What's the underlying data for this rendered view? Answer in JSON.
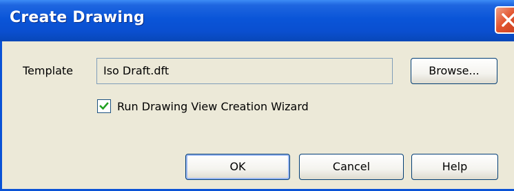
{
  "window": {
    "title": "Create Drawing"
  },
  "form": {
    "template_label": "Template",
    "template_value": "Iso Draft.dft",
    "browse_label": "Browse...",
    "wizard_checkbox_label": "Run Drawing View Creation Wizard",
    "wizard_checked": true
  },
  "buttons": {
    "ok": "OK",
    "cancel": "Cancel",
    "help": "Help"
  },
  "icons": {
    "close": "close-icon",
    "check": "checkmark-icon"
  },
  "colors": {
    "titlebar": "#0a55d8",
    "close_button": "#e2552f",
    "dialog_background": "#ece9d8",
    "check_mark": "#21a121"
  }
}
